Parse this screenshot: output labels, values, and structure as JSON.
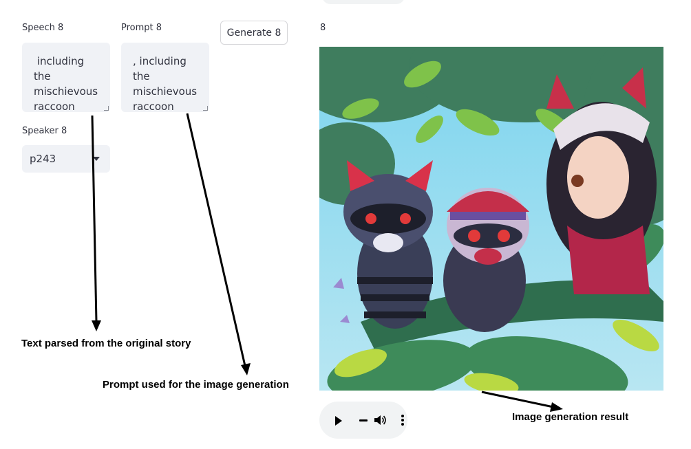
{
  "speech": {
    "label": "Speech 8",
    "text": " including\nthe\nmischievous\nraccoon"
  },
  "prompt": {
    "label": "Prompt 8",
    "text": ", including\nthe\nmischievous\nraccoon"
  },
  "generate_button": "Generate 8",
  "speaker": {
    "label": "Speaker 8",
    "value": "p243"
  },
  "image_label": "8",
  "annotations": {
    "speech_note": "Text parsed from the original story",
    "prompt_note": "Prompt used for the image generation",
    "image_note": "Image generation result"
  },
  "icons": {
    "play": "play-icon",
    "volume": "volume-icon",
    "more": "more-vert-icon",
    "dropdown": "chevron-down-icon"
  },
  "colors": {
    "input_bg": "#f0f2f6",
    "text": "#31333f",
    "annotation": "#000000",
    "audio_bg": "#f1f3f4"
  }
}
